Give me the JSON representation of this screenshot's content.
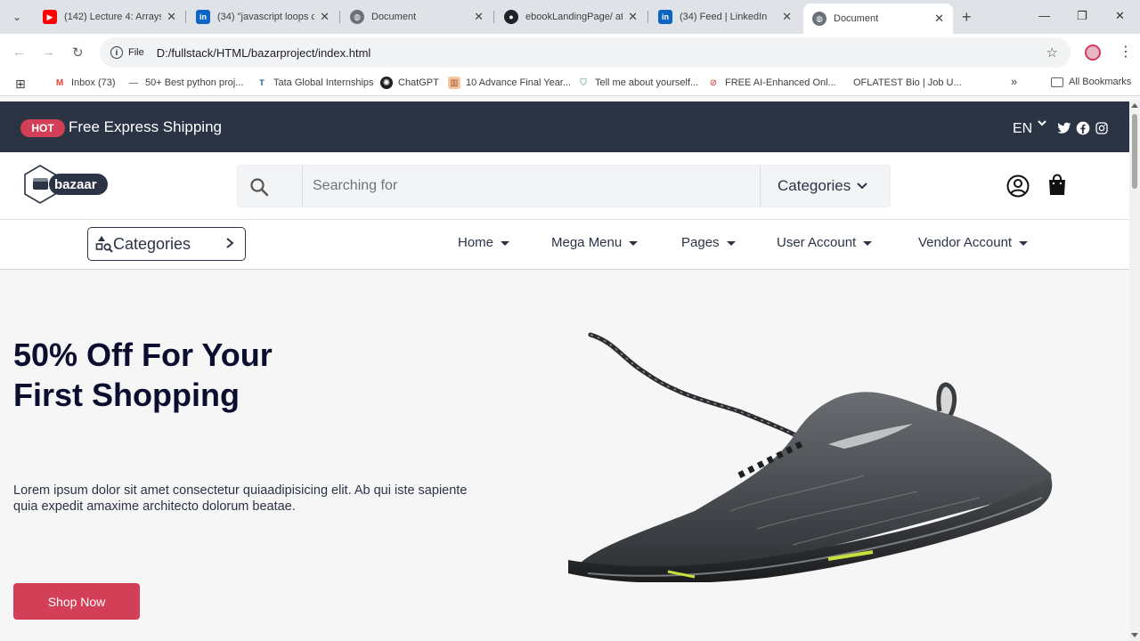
{
  "browser": {
    "tabs": [
      {
        "title": "(142) Lecture 4: Arrays",
        "favicon": "youtube-icon"
      },
      {
        "title": "(34) \"javascript loops c",
        "favicon": "linkedin-icon"
      },
      {
        "title": "Document",
        "favicon": "globe-icon"
      },
      {
        "title": "ebookLandingPage/ at",
        "favicon": "github-icon"
      },
      {
        "title": "(34) Feed | LinkedIn",
        "favicon": "linkedin-icon"
      },
      {
        "title": "Document",
        "favicon": "globe-icon",
        "active": true
      }
    ],
    "address": {
      "scheme_label": "File",
      "url": "D:/fullstack/HTML/bazarproject/index.html"
    },
    "bookmarks": [
      {
        "label": "Inbox (73)",
        "icon": "gmail-icon"
      },
      {
        "label": "50+ Best python proj...",
        "icon": "dash-icon"
      },
      {
        "label": "Tata Global Internships",
        "icon": "tata-icon"
      },
      {
        "label": "ChatGPT",
        "icon": "chatgpt-icon"
      },
      {
        "label": "10 Advance Final Year...",
        "icon": "bookmark-icon"
      },
      {
        "label": "Tell me about yourself...",
        "icon": "leaf-icon"
      },
      {
        "label": "FREE AI-Enhanced Onl...",
        "icon": "ai-icon"
      },
      {
        "label": "OFLATEST Bio | Job U...",
        "icon": "blank-icon"
      }
    ],
    "all_bookmarks": "All Bookmarks",
    "overflow": "»"
  },
  "topbar": {
    "badge": "HOT",
    "shipping": "Free Express Shipping",
    "language": "EN"
  },
  "header": {
    "logo_text": "bazaar",
    "search_placeholder": "Searching for",
    "categories_label": "Categories"
  },
  "navbar": {
    "categories_button": "Categories",
    "items": [
      "Home",
      "Mega Menu",
      "Pages",
      "User Account",
      "Vendor Account"
    ]
  },
  "hero": {
    "title_line1": "50% Off For Your",
    "title_line2": "First Shopping",
    "text": "Lorem ipsum dolor sit amet consectetur quiaadipisicing elit. Ab qui iste sapiente quia expedit amaxime architecto dolorum beatae.",
    "cta": "Shop Now"
  },
  "colors": {
    "topbar_bg": "#2b3445",
    "accent": "#d23f57",
    "heading": "#0c0e30"
  }
}
